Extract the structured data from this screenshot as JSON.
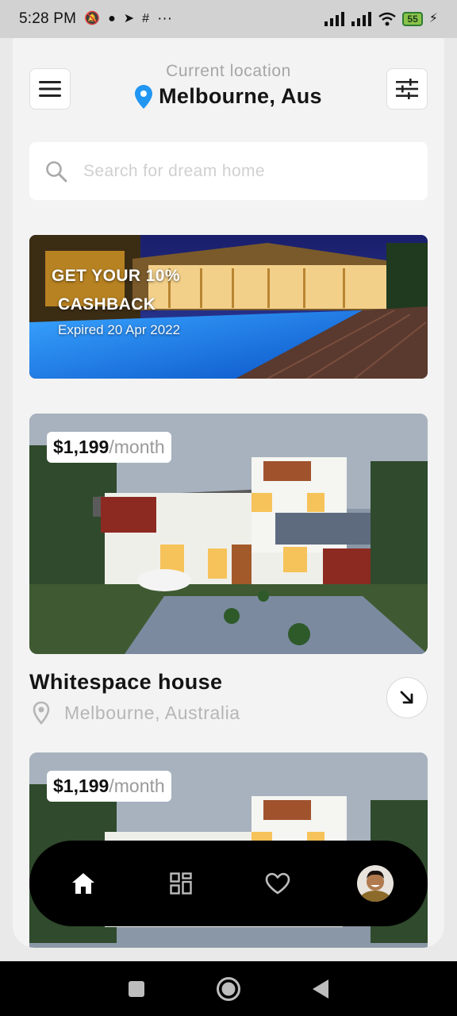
{
  "status_bar": {
    "time": "5:28 PM",
    "more": "···",
    "battery": "55"
  },
  "header": {
    "location_caption": "Current location",
    "location_name": "Melbourne, Aus"
  },
  "search": {
    "placeholder": "Search for dream home"
  },
  "promo": {
    "title_line1": "GET YOUR 10%",
    "title_line2": "CASHBACK",
    "subtitle": "Expired 20 Apr 2022"
  },
  "listings": [
    {
      "price": "$1,199",
      "period": "/month",
      "title": "Whitespace house",
      "location": "Melbourne, Australia"
    },
    {
      "price": "$1,199",
      "period": "/month"
    }
  ],
  "bottom_nav": {
    "items": [
      "home-icon",
      "grid-icon",
      "heart-icon",
      "avatar"
    ],
    "active": "home-icon"
  },
  "colors": {
    "accent_pin": "#2196f3",
    "background": "#f3f3f3",
    "nav_background": "#000000"
  }
}
